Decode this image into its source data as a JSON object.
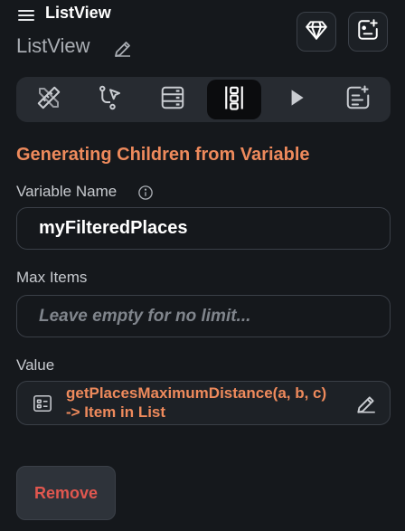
{
  "header": {
    "title": "ListView",
    "subtitle": "ListView"
  },
  "tabs": [
    {
      "icon": "ruler-pencil-icon",
      "active": false
    },
    {
      "icon": "cursor-path-icon",
      "active": false
    },
    {
      "icon": "server-icon",
      "active": false
    },
    {
      "icon": "list-columns-icon",
      "active": true
    },
    {
      "icon": "play-icon",
      "active": false
    },
    {
      "icon": "notes-plus-icon",
      "active": false
    }
  ],
  "section": {
    "title": "Generating Children from Variable"
  },
  "variable": {
    "label": "Variable Name",
    "value": "myFilteredPlaces"
  },
  "max_items": {
    "label": "Max Items",
    "placeholder": "Leave empty for no limit..."
  },
  "value": {
    "label": "Value",
    "line1": "getPlacesMaximumDistance(a, b, c)",
    "line2": "-> Item in List"
  },
  "actions": {
    "remove": "Remove"
  },
  "colors": {
    "accent": "#ee8a5c",
    "danger": "#e0574f",
    "background": "#15181c"
  }
}
